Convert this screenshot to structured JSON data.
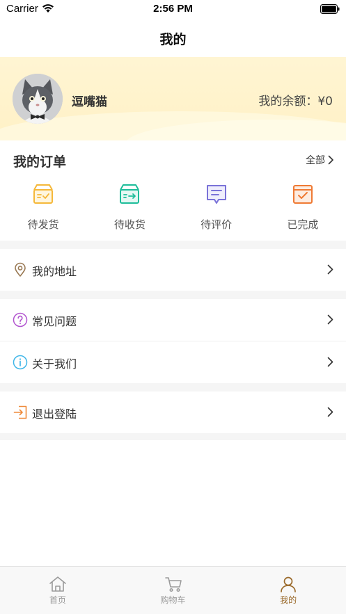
{
  "status_bar": {
    "carrier": "Carrier",
    "time": "2:56 PM"
  },
  "nav": {
    "title": "我的"
  },
  "profile": {
    "username": "逗嘴猫",
    "balance_label": "我的余额：",
    "balance_value": "¥0"
  },
  "orders": {
    "title": "我的订单",
    "all_label": "全部",
    "items": [
      {
        "label": "待发货",
        "icon": "box-check-icon",
        "color": "#f5b83a"
      },
      {
        "label": "待收货",
        "icon": "box-arrow-icon",
        "color": "#1dbd9a"
      },
      {
        "label": "待评价",
        "icon": "comment-icon",
        "color": "#7a72d8"
      },
      {
        "label": "已完成",
        "icon": "calendar-check-icon",
        "color": "#ef7a34"
      }
    ]
  },
  "menu": {
    "address": {
      "label": "我的地址",
      "icon": "location-pin-icon",
      "color": "#9a7a55"
    },
    "faq": {
      "label": "常见问题",
      "icon": "question-circle-icon",
      "color": "#b255cf"
    },
    "about": {
      "label": "关于我们",
      "icon": "info-circle-icon",
      "color": "#3fb6e8"
    },
    "logout": {
      "label": "退出登陆",
      "icon": "logout-icon",
      "color": "#ef8a3a"
    }
  },
  "tabbar": {
    "items": [
      {
        "label": "首页",
        "icon": "home-icon",
        "active": false
      },
      {
        "label": "购物车",
        "icon": "cart-icon",
        "active": false
      },
      {
        "label": "我的",
        "icon": "person-icon",
        "active": true
      }
    ],
    "active_color": "#9a6a2b",
    "inactive_color": "#999999"
  }
}
